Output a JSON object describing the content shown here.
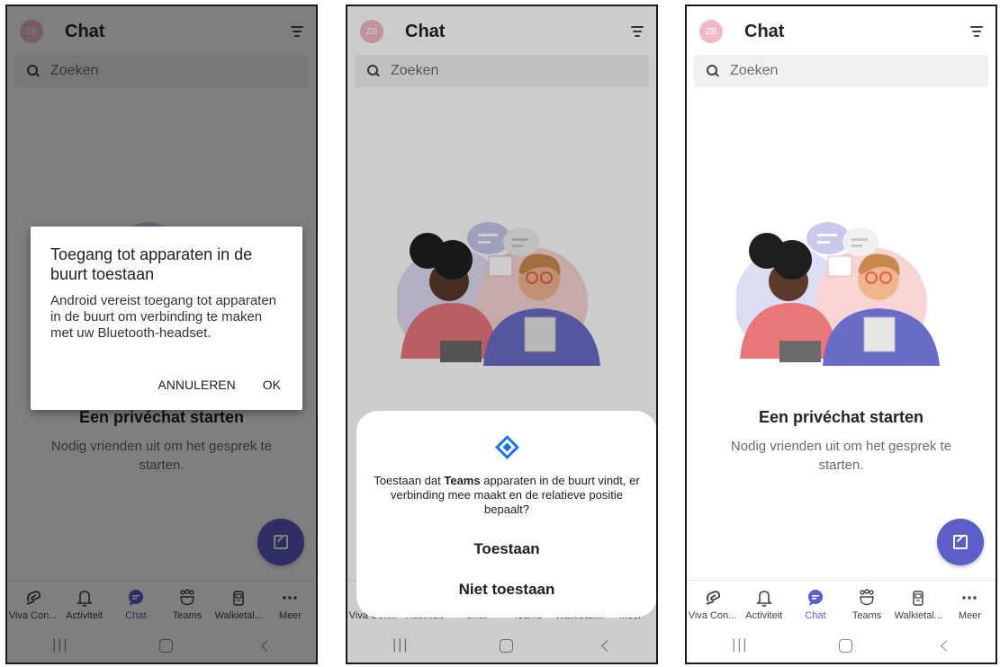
{
  "app": {
    "title": "Chat",
    "avatar_initials": "ZB",
    "search_placeholder": "Zoeken",
    "empty_title": "Een privéchat starten",
    "empty_subtitle": "Nodig vrienden uit om het gesprek te starten."
  },
  "nav": [
    {
      "label": "Viva Con...",
      "icon": "viva-connections-icon"
    },
    {
      "label": "Activiteit",
      "icon": "bell-icon"
    },
    {
      "label": "Chat",
      "icon": "chat-icon",
      "active": true
    },
    {
      "label": "Teams",
      "icon": "teams-icon"
    },
    {
      "label": "Walkietal...",
      "icon": "walkie-talkie-icon"
    },
    {
      "label": "Meer",
      "icon": "more-icon"
    }
  ],
  "dialog": {
    "title": "Toegang tot apparaten in de buurt toestaan",
    "body": "Android vereist toegang tot apparaten in de buurt om verbinding te maken met uw Bluetooth-headset.",
    "cancel": "ANNULEREN",
    "ok": "OK"
  },
  "permission": {
    "message_prefix": "Toestaan dat ",
    "app_name": "Teams",
    "message_suffix": " apparaten in de buurt vindt, er verbinding mee maakt en de relatieve positie bepaalt?",
    "allow": "Toestaan",
    "deny": "Niet toestaan"
  },
  "colors": {
    "accent": "#5b5fc7",
    "avatar": "#f2b8c6",
    "permission_icon": "#1a73e8"
  }
}
